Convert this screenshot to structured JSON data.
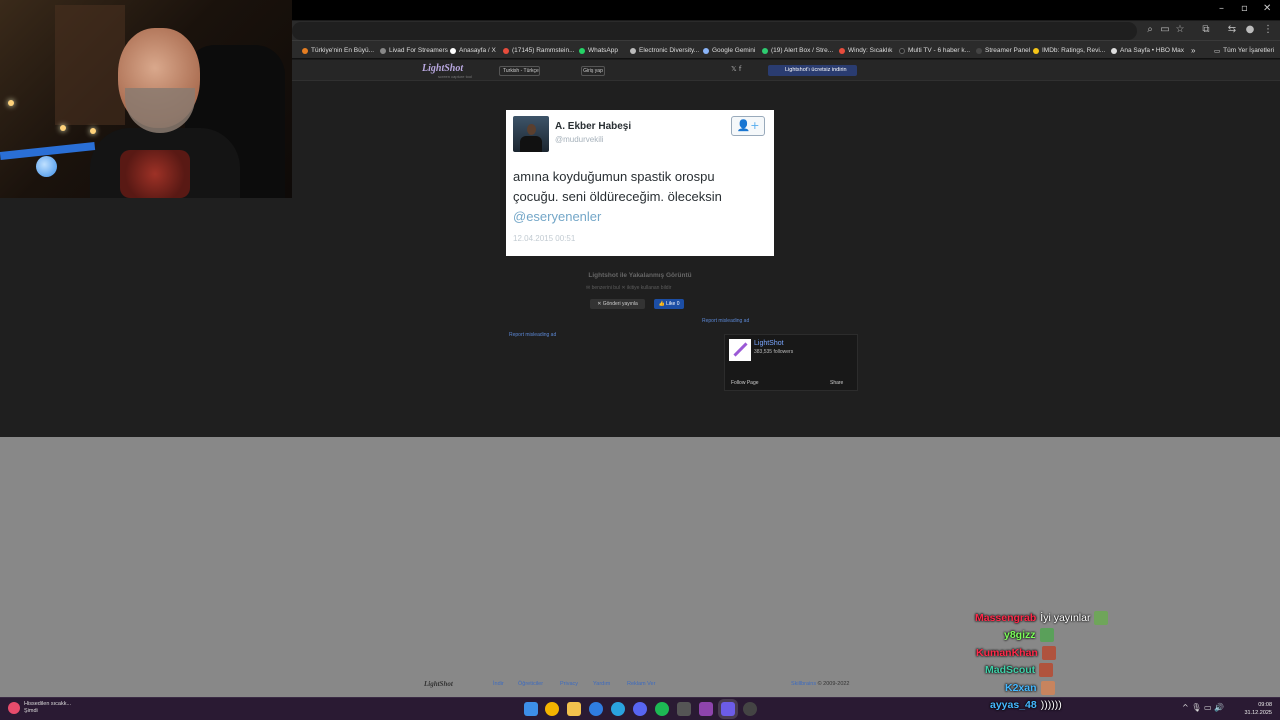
{
  "colors": {
    "page_bg": "#1f1f1f",
    "grey_area": "#888888",
    "taskbar": "#2a1a33",
    "link": "#5b87d4",
    "mention": "#74a7c8"
  },
  "window": {
    "minimize": "–",
    "maximize": "▫",
    "close": "✕"
  },
  "toolbar_icons": [
    "search-icon",
    "screencast-icon",
    "star-icon",
    "extensions-icon",
    "split-icon",
    "profile-icon",
    "menu-icon"
  ],
  "bookmarks": {
    "items": [
      {
        "label": "Türkiye'nin En Büyü...",
        "color": "#e67e22"
      },
      {
        "label": "Livad For Streamers",
        "color": "#888"
      },
      {
        "label": "Anasayfa / X",
        "color": "#fff"
      },
      {
        "label": "(17145) Rammstein...",
        "color": "#e74c3c"
      },
      {
        "label": "WhatsApp",
        "color": "#25d366"
      },
      {
        "label": "Electronic Diversity...",
        "color": "#bbb"
      },
      {
        "label": "Google Gemini",
        "color": "#8ab4f8"
      },
      {
        "label": "(19) Alert Box / Stre...",
        "color": "#2ecc71"
      },
      {
        "label": "Windy: Sıcaklık",
        "color": "#e74c3c"
      },
      {
        "label": "Multi TV - 6 haber k...",
        "color": "#222"
      },
      {
        "label": "Streamer Panel",
        "color": "#444"
      },
      {
        "label": "IMDb: Ratings, Revi...",
        "color": "#f5c518"
      },
      {
        "label": "Ana Sayfa • HBO Max",
        "color": "#ddd"
      }
    ],
    "more": "»",
    "all_bookmarks": "Tüm Yer İşaretleri"
  },
  "lightshot": {
    "logo": "LightShot",
    "logo_sub": "screen capture tool",
    "language": "Turkish - Türkçe",
    "login": "Giriş yap",
    "social": "𝕏  f",
    "download": "Lightshot'ı ücretsiz indirin",
    "caption": "Lightshot ile Yakalanmış Görüntü",
    "meta": "✉ benzerini bul    ✕ ikitiye kullanan bildir",
    "tweet_btn": "✕ Gönderi yayınla",
    "like_btn": "👍 Like 0",
    "report_right": "Report misleading ad",
    "report_left": "Report misleading ad"
  },
  "tweet": {
    "name": "A. Ekber Habeşi",
    "handle": "@mudurvekili",
    "text": "amına koyduğumun spastik orospu çocuğu. seni öldüreceğim. öleceksin",
    "mention": "@eseryenenler",
    "date": "12.04.2015 00:51",
    "follow_icon": "👤+"
  },
  "fb_widget": {
    "name": "LightShot",
    "followers": "383,535 followers",
    "follow": "Follow Page",
    "share": "Share"
  },
  "footer": {
    "logo": "LightShot",
    "links": [
      "İndir",
      "Öğreticiler",
      "Privacy",
      "Yardım",
      "Reklam Ver"
    ],
    "company": "Skillbrains",
    "copyright": " © 2009-2022"
  },
  "chat": [
    {
      "user": "Massengrab",
      "color": "#ff2a4a",
      "msg": "İyi yayınlar",
      "emote": "#6fa55a"
    },
    {
      "user": "y8gizz",
      "color": "#7cff5a",
      "msg": "",
      "emote": "#5aa05a"
    },
    {
      "user": "KumanKhan",
      "color": "#ff2a4a",
      "msg": "",
      "emote": "#b0533e"
    },
    {
      "user": "MadScout",
      "color": "#3fd0a8",
      "msg": "",
      "emote": "#b0533e"
    },
    {
      "user": "K2xan",
      "color": "#45b8ff",
      "msg": "",
      "emote": "#c7845e"
    },
    {
      "user": "ayyas_48",
      "color": "#45b8ff",
      "msg": "))))))",
      "emote": ""
    }
  ],
  "taskbar": {
    "weather_title": "Hissedilen sıcakk...",
    "weather_sub": "Şimdi",
    "apps": [
      {
        "name": "start-icon",
        "color": "#3d8fe8"
      },
      {
        "name": "chrome-icon",
        "color": "#f4b400"
      },
      {
        "name": "folder-icon",
        "color": "#f2c14e"
      },
      {
        "name": "edge-icon",
        "color": "#2f7de1"
      },
      {
        "name": "telegram-icon",
        "color": "#2aa3e0"
      },
      {
        "name": "discord-icon",
        "color": "#5865f2"
      },
      {
        "name": "spotify-icon",
        "color": "#1db954"
      },
      {
        "name": "calculator-icon",
        "color": "#555"
      },
      {
        "name": "next-icon",
        "color": "#8e44ad"
      },
      {
        "name": "lightshot-icon",
        "color": "#6c5ce7"
      },
      {
        "name": "obs-icon",
        "color": "#444"
      }
    ],
    "tray": "^  🎙  ▭  🔊",
    "time": "09:08",
    "date": "31.12.2025"
  }
}
